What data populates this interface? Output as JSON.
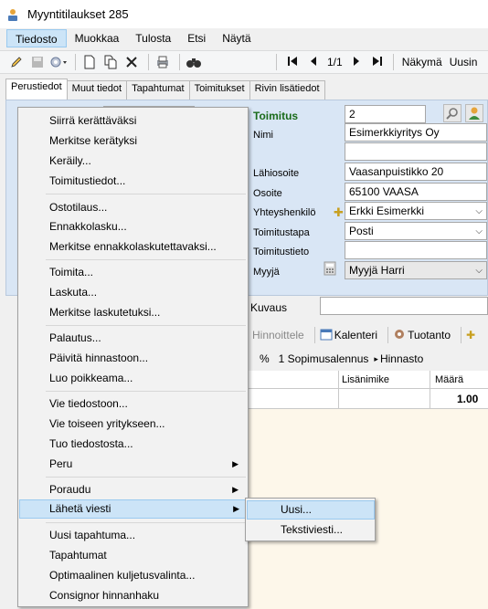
{
  "window": {
    "title": "Myyntitilaukset 285"
  },
  "menubar": {
    "items": [
      "Tiedosto",
      "Muokkaa",
      "Tulosta",
      "Etsi",
      "Näytä"
    ]
  },
  "toolbar": {
    "record_position": "1/1",
    "view_label": "Näkymä",
    "view_value": "Uusin"
  },
  "tabs": [
    "Perustiedot",
    "Muut tiedot",
    "Tapahtumat",
    "Toimitukset",
    "Rivin lisätiedot"
  ],
  "form": {
    "toimitus_label": "Toimitus",
    "toimitus_value": "2",
    "nimi_label": "Nimi",
    "nimi_value": "Esimerkkiyritys Oy",
    "lahiosoite_label": "Lähiosoite",
    "lahiosoite_value": "Vaasanpuistikko 20",
    "osoite_label": "Osoite",
    "osoite_value": "65100  VAASA",
    "yhteyshenkilo_label": "Yhteyshenkilö",
    "yhteyshenkilo_value": "Erkki Esimerkki",
    "toimitustapa_label": "Toimitustapa",
    "toimitustapa_value": "Posti",
    "toimitustieto_label": "Toimitustieto",
    "myyja_label": "Myyjä",
    "myyja_value": "Myyjä Harri"
  },
  "lower": {
    "kuvaus_label": "Kuvaus",
    "hinnoittele": "Hinnoittele",
    "kalenteri": "Kalenteri",
    "tuotanto": "Tuotanto",
    "percent": "%",
    "sopimusalennus": "1 Sopimusalennus",
    "hinnasto": "Hinnasto",
    "col_lisanimike": "Lisänimike",
    "col_maara": "Määrä",
    "row_maara": "1.00"
  },
  "context_menu": {
    "items": [
      "Siirrä kerättäväksi",
      "Merkitse kerätyksi",
      "Keräily...",
      "Toimitustiedot...",
      "Ostotilaus...",
      "Ennakkolasku...",
      "Merkitse ennakkolaskutettavaksi...",
      "Toimita...",
      "Laskuta...",
      "Merkitse laskutetuksi...",
      "Palautus...",
      "Päivitä hinnastoon...",
      "Luo poikkeama...",
      "Vie tiedostoon...",
      "Vie toiseen yritykseen...",
      "Tuo tiedostosta...",
      "Peru",
      "Poraudu",
      "Lähetä viesti",
      "Uusi tapahtuma...",
      "Tapahtumat",
      "Optimaalinen kuljetusvalinta...",
      "Consignor hinnanhaku"
    ]
  },
  "submenu": {
    "items": [
      "Uusi...",
      "Tekstiviesti..."
    ]
  },
  "colors": {
    "selection": "#cce4f7",
    "panel": "#d9e6f5",
    "grid": "#fdf7ea"
  }
}
